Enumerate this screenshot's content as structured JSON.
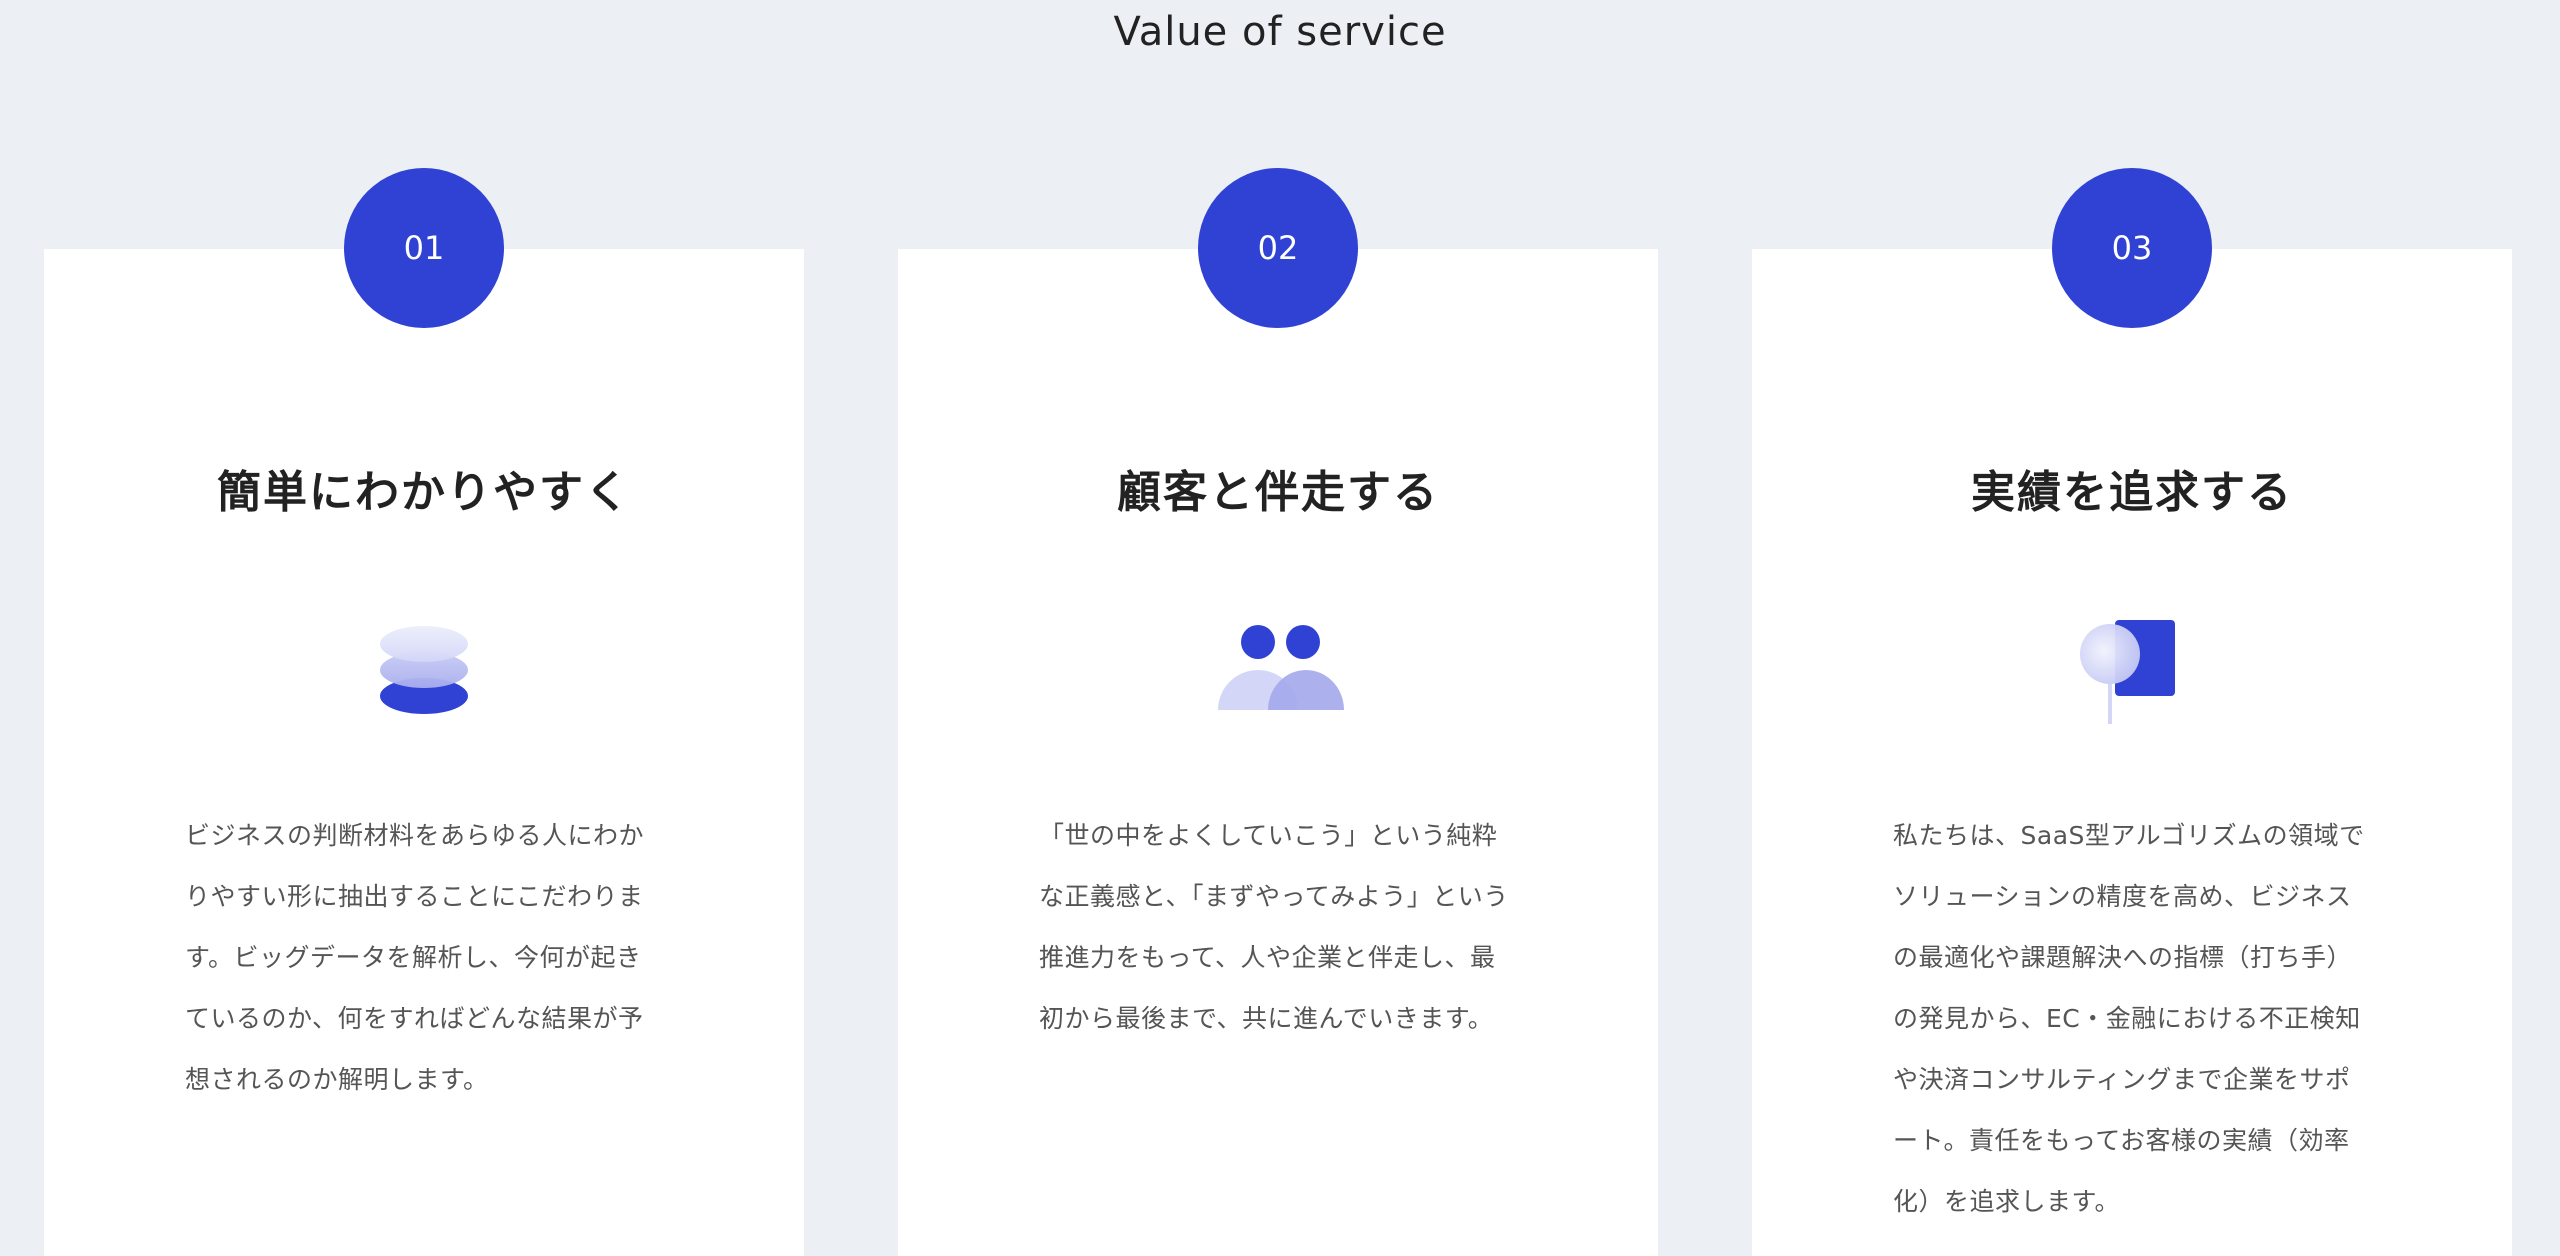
{
  "section": {
    "title": "Value of service"
  },
  "colors": {
    "background": "#ecf0f5",
    "card": "#ffffff",
    "accent": "#3042d4",
    "accent_light": "#c9ccf5"
  },
  "cards": [
    {
      "number": "01",
      "title": "簡単にわかりやすく",
      "icon": "stacked-layers-icon",
      "text": "ビジネスの判断材料をあらゆる人にわかりやすい形に抽出することにこだわります。ビッグデータを解析し、今何が起きているのか、何をすればどんな結果が予想されるのか解明します。"
    },
    {
      "number": "02",
      "title": "顧客と伴走する",
      "icon": "two-people-icon",
      "text": "「世の中をよくしていこう」という純粋な正義感と、「まずやってみよう」という推進力をもって、人や企業と伴走し、最初から最後まで、共に進んでいきます。"
    },
    {
      "number": "03",
      "title": "実績を追求する",
      "icon": "pin-and-square-icon",
      "text": "私たちは、SaaS型アルゴリズムの領域でソリューションの精度を高め、ビジネスの最適化や課題解決への指標（打ち手）の発見から、EC・金融における不正検知や決済コンサルティングまで企業をサポート。責任をもってお客様の実績（効率化）を追求します。"
    }
  ]
}
